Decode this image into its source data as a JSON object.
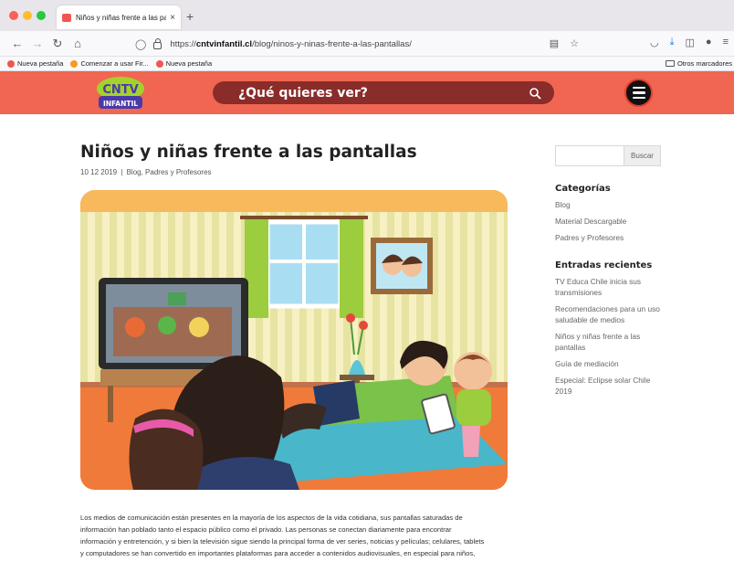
{
  "browser": {
    "tab": {
      "title": "Niños y niñas frente a las pantal"
    },
    "url": {
      "host": "cntvinfantil.cl",
      "prefix": "https://",
      "path": "/blog/ninos-y-ninas-frente-a-las-pantallas/"
    },
    "bookmarks": [
      {
        "label": "Nueva pestaña",
        "icon": "red-favicon"
      },
      {
        "label": "Comenzar a usar Fir...",
        "icon": "firefox-icon"
      },
      {
        "label": "Nueva pestaña",
        "icon": "red-favicon"
      }
    ],
    "other_bookmarks": "Otros marcadores"
  },
  "site": {
    "logo": {
      "line1": "CNTV",
      "line2": "INFANTIL"
    },
    "search_prompt": "¿Qué quieres ver?",
    "colors": {
      "header": "#f06652",
      "search_pill": "#8a2c2a"
    }
  },
  "article": {
    "title": "Niños y niñas frente a las pantallas",
    "date": "10 12 2019",
    "sep": "|",
    "categories": "Blog, Padres y Profesores",
    "body": [
      "Los medios de comunicación están presentes en la mayoría de los aspectos de la vida cotidiana, sus pantallas saturadas de",
      "información han poblado tanto el espacio público como el privado. Las personas se conectan diariamente para encontrar",
      "información y entretención, y si bien la televisión sigue siendo la principal forma de ver series, noticias y películas; celulares, tablets",
      "y computadores se han convertido en importantes plataformas para acceder a contenidos audiovisuales, en especial para niños,"
    ]
  },
  "sidebar": {
    "search_button": "Buscar",
    "categories_title": "Categorías",
    "categories": [
      "Blog",
      "Material Descargable",
      "Padres y Profesores"
    ],
    "recent_title": "Entradas recientes",
    "recent": [
      "TV Educa Chile inicia sus transmisiones",
      "Recomendaciones para un uso saludable de medios",
      "Niños y niñas frente a las pantallas",
      "Guía de mediación",
      "Especial: Eclipse solar Chile 2019"
    ]
  }
}
